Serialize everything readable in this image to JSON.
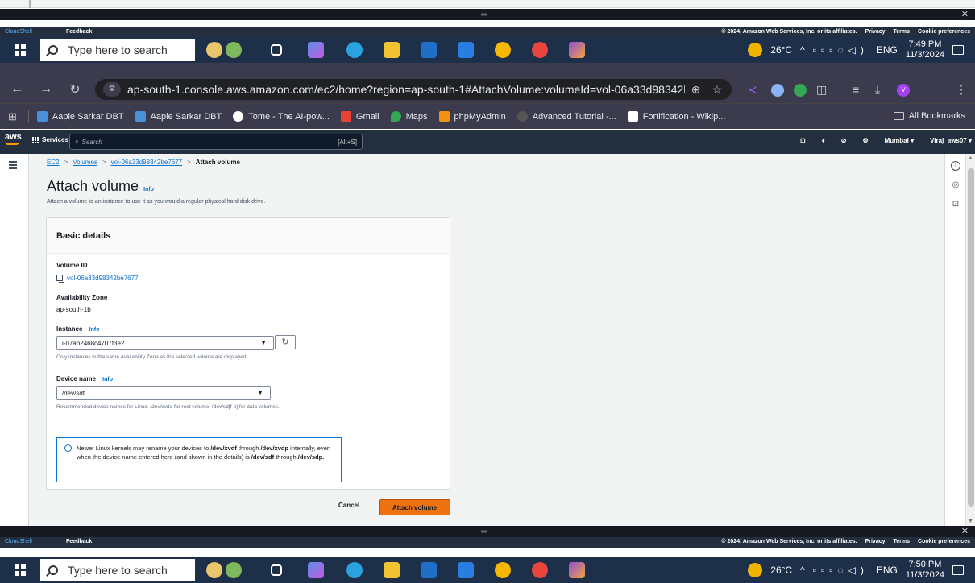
{
  "taskbar": {
    "search_placeholder": "Type here to search",
    "weather": "26°C",
    "lang": "ENG",
    "top_time": "7:49 PM",
    "top_date": "11/3/2024",
    "bottom_time": "7:50 PM",
    "bottom_date": "11/3/2024"
  },
  "cloudshell": {
    "cloudshell_label": "CloudShell",
    "feedback_label": "Feedback",
    "copyright": "© 2024, Amazon Web Services, Inc. or its affiliates.",
    "privacy": "Privacy",
    "terms": "Terms",
    "cookies": "Cookie preferences"
  },
  "browser": {
    "url": "ap-south-1.console.aws.amazon.com/ec2/home?region=ap-south-1#AttachVolume:volumeId=vol-06a33d98342be7...",
    "bookmarks": [
      "Aaple Sarkar DBT",
      "Aaple Sarkar DBT",
      "Tome - The AI-pow...",
      "Gmail",
      "Maps",
      "phpMyAdmin",
      "Advanced Tutorial -...",
      "Fortification - Wikip..."
    ],
    "all_bookmarks": "All Bookmarks",
    "profile_initial": "V"
  },
  "aws": {
    "logo": "aws",
    "services": "Services",
    "search_placeholder": "Search",
    "search_shortcut": "[Alt+S]",
    "region": "Mumbai ▾",
    "account": "Viraj_aws07 ▾"
  },
  "page": {
    "breadcrumbs": [
      "EC2",
      "Volumes",
      "vol-06a33d98342be7677",
      "Attach volume"
    ],
    "title": "Attach volume",
    "info": "Info",
    "subtitle": "Attach a volume to an instance to use it as you would a regular physical hard disk drive.",
    "panel_title": "Basic details",
    "volume_id_label": "Volume ID",
    "volume_id": "vol-06a33d98342be7677",
    "az_label": "Availability Zone",
    "az": "ap-south-1b",
    "instance_label": "Instance",
    "instance_value": "i-07ab2468c4707f3e2",
    "instance_hint": "Only instances in the same Availability Zone as the selected volume are displayed.",
    "device_label": "Device name",
    "device_value": "/dev/sdf",
    "device_hint": "Recommended device names for Linux: /dev/xvda for root volume. /dev/sd[f-p] for data volumes.",
    "alert_1": "Newer Linux kernels may rename your devices to ",
    "alert_b1": "/dev/xvdf",
    "alert_2": " through ",
    "alert_b2": "/dev/xvdp",
    "alert_3": " internally, even when the device name entered here (and shown in the details) is ",
    "alert_b3": "/dev/sdf",
    "alert_4": " through ",
    "alert_b4": "/dev/sdp.",
    "cancel": "Cancel",
    "attach": "Attach volume"
  }
}
